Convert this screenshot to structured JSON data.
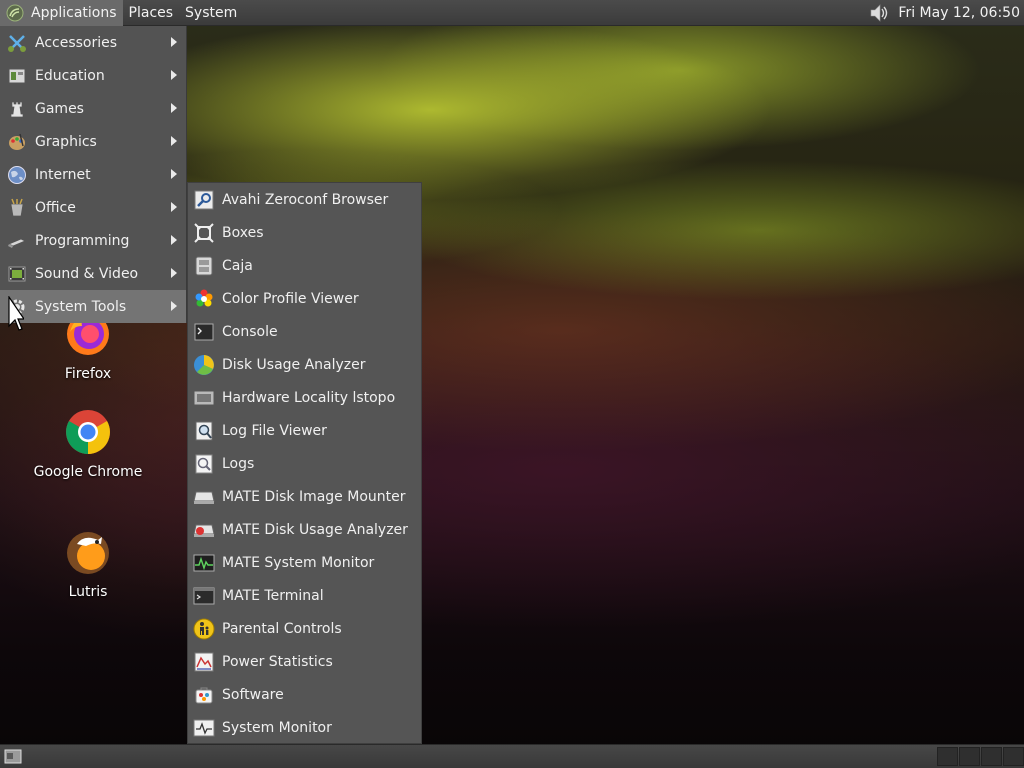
{
  "top_panel": {
    "menus": [
      "Applications",
      "Places",
      "System"
    ],
    "clock": "Fri May 12, 06:50"
  },
  "app_menu": {
    "categories": [
      {
        "label": "Accessories",
        "icon": "accessories-icon"
      },
      {
        "label": "Education",
        "icon": "education-icon"
      },
      {
        "label": "Games",
        "icon": "games-icon"
      },
      {
        "label": "Graphics",
        "icon": "graphics-icon"
      },
      {
        "label": "Internet",
        "icon": "internet-icon"
      },
      {
        "label": "Office",
        "icon": "office-icon"
      },
      {
        "label": "Programming",
        "icon": "programming-icon"
      },
      {
        "label": "Sound & Video",
        "icon": "sound-video-icon"
      },
      {
        "label": "System Tools",
        "icon": "system-tools-icon",
        "active": true
      }
    ]
  },
  "submenu": {
    "items": [
      {
        "label": "Avahi Zeroconf Browser",
        "icon": "avahi-icon"
      },
      {
        "label": "Boxes",
        "icon": "boxes-icon"
      },
      {
        "label": "Caja",
        "icon": "caja-icon"
      },
      {
        "label": "Color Profile Viewer",
        "icon": "color-profile-icon"
      },
      {
        "label": "Console",
        "icon": "console-icon"
      },
      {
        "label": "Disk Usage Analyzer",
        "icon": "disk-usage-icon"
      },
      {
        "label": "Hardware Locality lstopo",
        "icon": "hardware-locality-icon"
      },
      {
        "label": "Log File Viewer",
        "icon": "log-viewer-icon"
      },
      {
        "label": "Logs",
        "icon": "logs-icon"
      },
      {
        "label": "MATE Disk Image Mounter",
        "icon": "disk-mounter-icon"
      },
      {
        "label": "MATE Disk Usage Analyzer",
        "icon": "mate-disk-usage-icon"
      },
      {
        "label": "MATE System Monitor",
        "icon": "system-monitor-icon"
      },
      {
        "label": "MATE Terminal",
        "icon": "terminal-icon"
      },
      {
        "label": "Parental Controls",
        "icon": "parental-controls-icon"
      },
      {
        "label": "Power Statistics",
        "icon": "power-statistics-icon"
      },
      {
        "label": "Software",
        "icon": "software-icon"
      },
      {
        "label": "System Monitor",
        "icon": "monitor-icon"
      }
    ]
  },
  "desktop_icons": [
    {
      "label": "Firefox",
      "icon": "firefox-icon"
    },
    {
      "label": "Google Chrome",
      "icon": "chrome-icon"
    },
    {
      "label": "Lutris",
      "icon": "lutris-icon"
    }
  ],
  "colors": {
    "panel": "#3f3f3f",
    "menu_bg": "#535353",
    "menu_active": "#747474",
    "submenu_bg": "#555555"
  }
}
